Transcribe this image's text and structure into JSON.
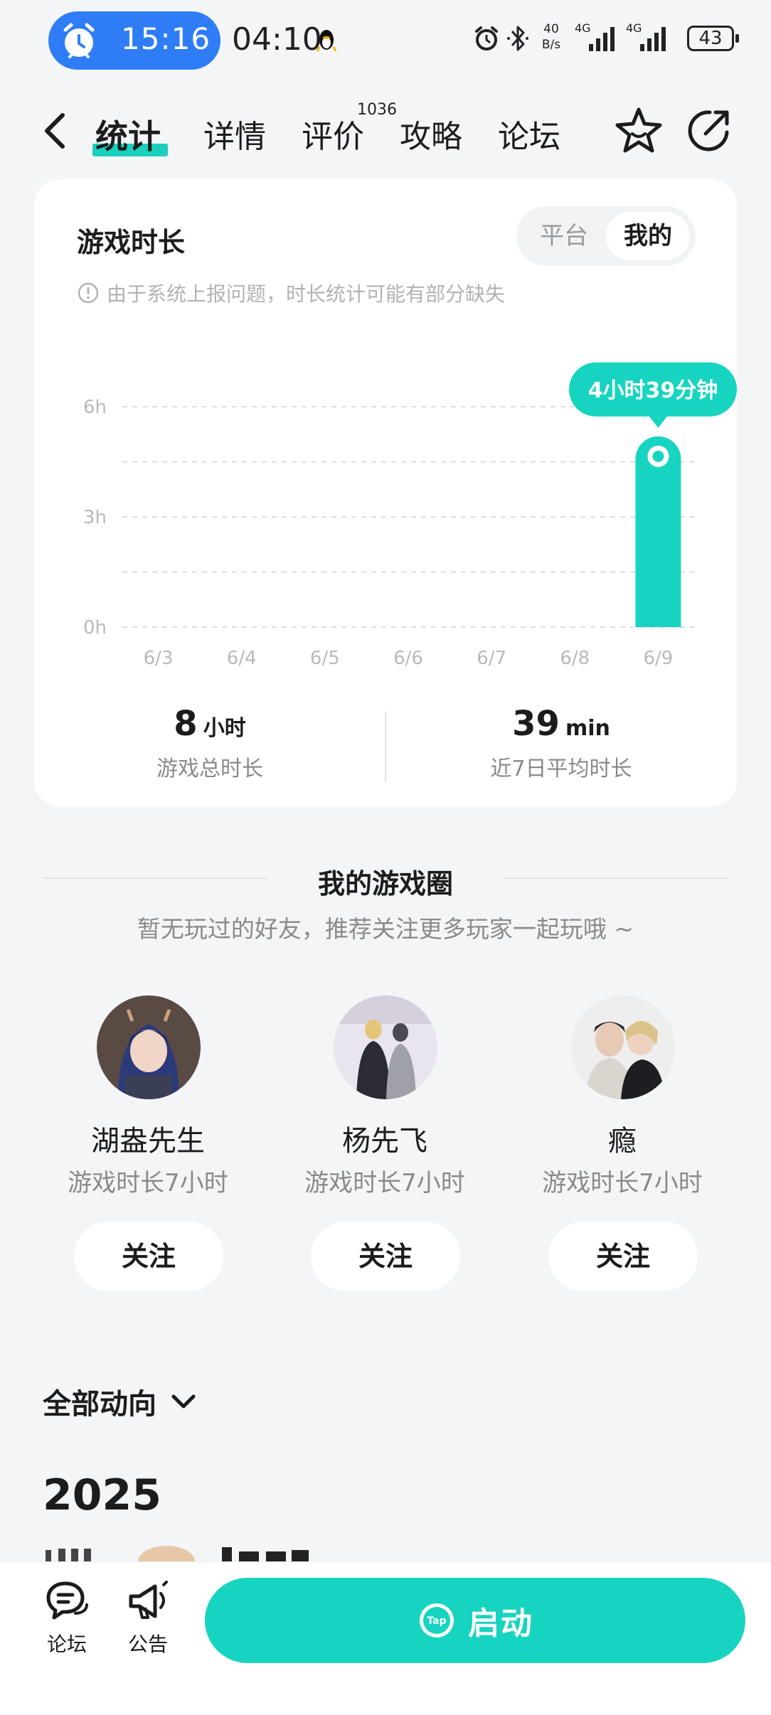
{
  "status_bar": {
    "alarm_time": "15:16",
    "clock": "04:10",
    "net_speed_value": "40",
    "net_speed_unit": "B/s",
    "signal_1": "4G",
    "signal_2": "4G",
    "battery": "43"
  },
  "nav": {
    "tabs": [
      {
        "label": "统计",
        "active": true
      },
      {
        "label": "详情",
        "active": false
      },
      {
        "label": "评价",
        "active": false
      },
      {
        "label": "攻略",
        "active": false
      },
      {
        "label": "论坛",
        "active": false
      }
    ],
    "review_count": "1036"
  },
  "playtime_card": {
    "title": "游戏时长",
    "segments": [
      "平台",
      "我的"
    ],
    "selected_segment": "我的",
    "notice": "由于系统上报问题，时长统计可能有部分缺失",
    "highlight_label": "4小时39分钟",
    "total_value": "8",
    "total_unit": "小时",
    "total_label": "游戏总时长",
    "avg_value": "39",
    "avg_unit": "min",
    "avg_label": "近7日平均时长"
  },
  "chart_data": {
    "type": "bar",
    "categories": [
      "6/3",
      "6/4",
      "6/5",
      "6/6",
      "6/7",
      "6/8",
      "6/9"
    ],
    "values": [
      0,
      0,
      0,
      0,
      0,
      0,
      4.65
    ],
    "unit": "h",
    "y_ticks": [
      "6h",
      "3h",
      "0h"
    ],
    "ylim": [
      0,
      6
    ],
    "grid": "dashed",
    "bar_color": "#17d4c0"
  },
  "game_circle": {
    "title": "我的游戏圈",
    "subtitle": "暂无玩过的好友，推荐关注更多玩家一起玩哦 ~",
    "friends": [
      {
        "name": "湖盎先生",
        "playtime": "游戏时长7小时",
        "follow": "关注"
      },
      {
        "name": "杨先飞",
        "playtime": "游戏时长7小时",
        "follow": "关注"
      },
      {
        "name": "瘾",
        "playtime": "游戏时长7小时",
        "follow": "关注"
      }
    ]
  },
  "feed": {
    "filter_label": "全部动向",
    "year": "2025"
  },
  "bottom_bar": {
    "forum_label": "论坛",
    "notice_label": "公告",
    "launch_label": "启动",
    "launch_logo_text": "Tap"
  }
}
